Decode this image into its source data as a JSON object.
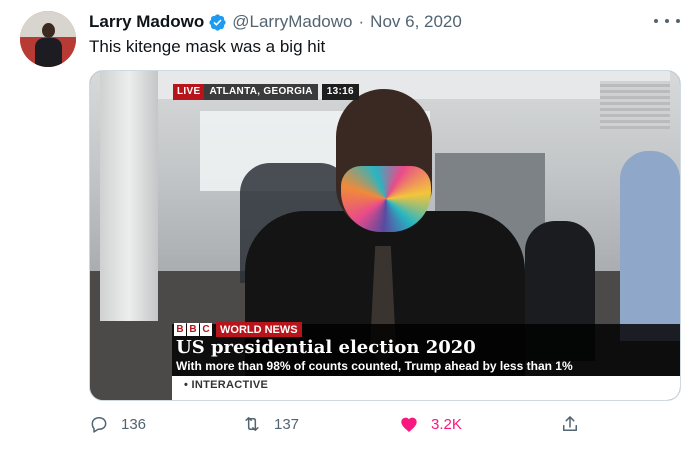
{
  "author": {
    "name": "Larry Madowo",
    "handle": "@LarryMadowo",
    "date": "Nov 6, 2020",
    "verified": true
  },
  "tweet": {
    "text": "This kitenge mask was a big hit"
  },
  "media": {
    "live_label": "LIVE",
    "location": "ATLANTA, GEORGIA",
    "time": "13:16",
    "channel_letters": [
      "B",
      "B",
      "C"
    ],
    "channel_name": "WORLD NEWS",
    "headline": "US presidential election 2020",
    "subheadline": "With more than 98% of counts counted, Trump ahead by less than 1%",
    "ticker": "• INTERACTIVE"
  },
  "actions": {
    "replies": "136",
    "retweets": "137",
    "likes": "3.2K",
    "liked": true
  },
  "colors": {
    "verified": "#1d9bf0",
    "like": "#f91880",
    "secondary_text": "#536471",
    "bbc_red": "#b8141b"
  }
}
